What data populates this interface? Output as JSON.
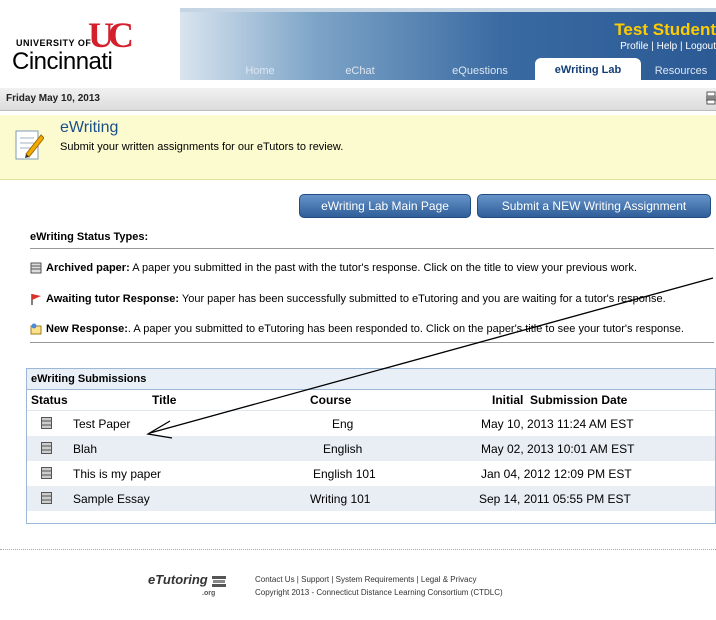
{
  "logo": {
    "line1": "UNIVERSITY OF",
    "mark": "UC",
    "line2": "Cincinnati"
  },
  "user": {
    "name": "Test Student",
    "links": [
      "Profile",
      "Help",
      "Logout"
    ],
    "separator": "|"
  },
  "nav": {
    "tabs": [
      "Home",
      "eChat",
      "eQuestions",
      "eWriting Lab",
      "Resources"
    ],
    "active": "eWriting Lab"
  },
  "datebar": {
    "date": "Friday May 10, 2013"
  },
  "page_header": {
    "title": "eWriting",
    "subtitle": "Submit your written assignments for our eTutors to review."
  },
  "buttons": {
    "main_page": "eWriting Lab Main Page",
    "submit_new": "Submit a NEW Writing Assignment"
  },
  "status_types": {
    "title": "eWriting Status Types:",
    "items": [
      {
        "label": "Archived paper:",
        "text": " A paper you submitted in the past with the tutor's response. Click on the title to view your previous work.",
        "icon": "archive-icon"
      },
      {
        "label": "Awaiting tutor Response:",
        "text": " Your paper has been successfully submitted to eTutoring and you are waiting for a tutor's response.",
        "icon": "flag-icon"
      },
      {
        "label": "New Response:",
        "text": ". A paper you submitted to eTutoring has been responded to. Click on the paper's title to see your tutor's response.",
        "icon": "new-response-icon"
      }
    ]
  },
  "submissions": {
    "title": "eWriting Submissions",
    "columns": [
      "Status",
      "Title",
      "Course",
      "Initial  Submission Date"
    ],
    "rows": [
      {
        "title": "Test Paper",
        "course": "Eng",
        "date": "May 10, 2013 11:24 AM EST"
      },
      {
        "title": "Blah",
        "course": "English",
        "date": "May 02, 2013 10:01 AM EST"
      },
      {
        "title": "This is my paper",
        "course": "English 101",
        "date": "Jan 04, 2012 12:09 PM EST"
      },
      {
        "title": "Sample Essay",
        "course": "Writing 101",
        "date": "Sep 14, 2011 05:55 PM EST"
      }
    ]
  },
  "footer": {
    "brand": "eTutoring",
    "brand_suffix": ".org",
    "links": [
      "Contact Us",
      "Support",
      "System Requirements",
      "Legal & Privacy"
    ],
    "copyright": "Copyright 2013 - Connecticut Distance Learning Consortium (CTDLC)"
  },
  "colors": {
    "accent": "#2f5e99",
    "user_name": "#ffcc00",
    "page_header_bg": "#fcfacf",
    "logo_red": "#d41f2c"
  }
}
